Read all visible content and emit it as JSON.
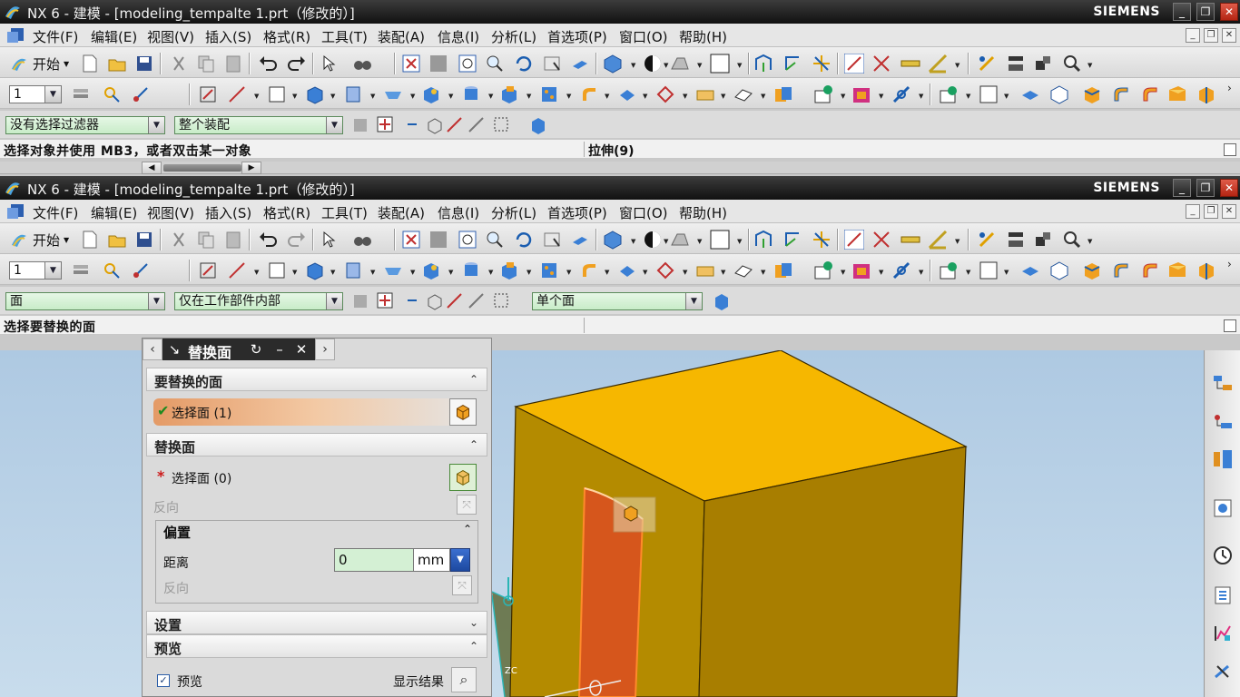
{
  "window1": {
    "title": "NX 6 - 建模 - [modeling_tempalte 1.prt（修改的）]",
    "brand": "SIEMENS",
    "menu": [
      "文件(F)",
      "编辑(E)",
      "视图(V)",
      "插入(S)",
      "格式(R)",
      "工具(T)",
      "装配(A)",
      "信息(I)",
      "分析(L)",
      "首选项(P)",
      "窗口(O)",
      "帮助(H)"
    ],
    "start_label": "开始",
    "layer_value": "1",
    "filter_type": "没有选择过滤器",
    "filter_scope": "整个装配",
    "cue": "选择对象并使用 MB3，或者双击某一对象",
    "status": "拉伸(9)"
  },
  "window2": {
    "title": "NX 6 - 建模 - [modeling_tempalte 1.prt（修改的）]",
    "brand": "SIEMENS",
    "menu": [
      "文件(F)",
      "编辑(E)",
      "视图(V)",
      "插入(S)",
      "格式(R)",
      "工具(T)",
      "装配(A)",
      "信息(I)",
      "分析(L)",
      "首选项(P)",
      "窗口(O)",
      "帮助(H)"
    ],
    "start_label": "开始",
    "layer_value": "1",
    "filter_type": "面",
    "filter_scope": "仅在工作部件内部",
    "face_rule": "单个面",
    "cue": "选择要替换的面"
  },
  "dialog": {
    "title": "替换面",
    "section_target": "要替换的面",
    "select_target": "选择面 (1)",
    "section_replacement": "替换面",
    "select_replacement": "选择面 (0)",
    "reverse1": "反向",
    "group_offset": "偏置",
    "distance_label": "距离",
    "distance_value": "0",
    "distance_unit": "mm",
    "reverse2": "反向",
    "section_settings": "设置",
    "section_preview": "预览",
    "preview_label": "预览",
    "show_result": "显示结果"
  },
  "viewport": {
    "axis_label": "ZC",
    "colors": {
      "body_top": "#f5b400",
      "body_front": "#b58a00",
      "body_side": "#a97e00",
      "selected_face": "#d9541e",
      "background": "#b7d0e6"
    }
  }
}
